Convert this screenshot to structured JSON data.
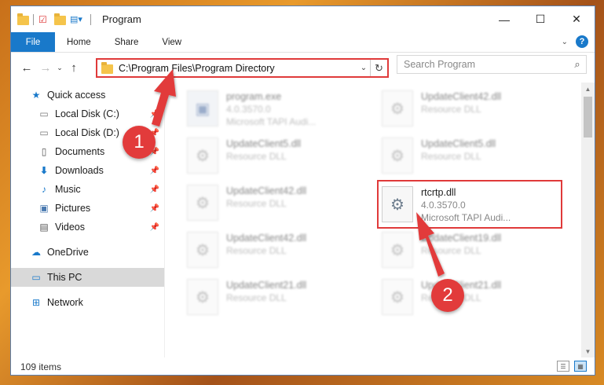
{
  "window": {
    "title": "Program"
  },
  "ribbon": {
    "tabs": [
      "File",
      "Home",
      "Share",
      "View"
    ]
  },
  "nav": {
    "address": "C:\\Program Files\\Program Directory",
    "search_placeholder": "Search Program"
  },
  "sidebar": {
    "items": [
      {
        "label": "Quick access",
        "icon": "star-icon",
        "pinned": false
      },
      {
        "label": "Local Disk (C:)",
        "icon": "drive-icon",
        "pinned": true
      },
      {
        "label": "Local Disk (D:)",
        "icon": "drive-icon",
        "pinned": true
      },
      {
        "label": "Documents",
        "icon": "documents-icon",
        "pinned": true
      },
      {
        "label": "Downloads",
        "icon": "download-icon",
        "pinned": true
      },
      {
        "label": "Music",
        "icon": "music-icon",
        "pinned": true
      },
      {
        "label": "Pictures",
        "icon": "pictures-icon",
        "pinned": true
      },
      {
        "label": "Videos",
        "icon": "videos-icon",
        "pinned": true
      }
    ],
    "onedrive": "OneDrive",
    "thispc": "This PC",
    "network": "Network"
  },
  "files": [
    {
      "name": "program.exe",
      "version": "4.0.3570.0",
      "desc": "Microsoft TAPI Audi...",
      "type": "exe"
    },
    {
      "name": "UpdateClient42.dll",
      "desc": "Resource DLL"
    },
    {
      "name": "UpdateClient5.dll",
      "desc": "Resource DLL"
    },
    {
      "name": "UpdateClient5.dll",
      "desc": "Resource DLL"
    },
    {
      "name": "UpdateClient42.dll",
      "desc": "Resource DLL"
    },
    {
      "name": "rtcrtp.dll",
      "version": "4.0.3570.0",
      "desc": "Microsoft TAPI Audi...",
      "highlighted": true
    },
    {
      "name": "UpdateClient42.dll",
      "desc": "Resource DLL"
    },
    {
      "name": "UpdateClient19.dll",
      "desc": "Resource DLL"
    },
    {
      "name": "UpdateClient21.dll",
      "desc": "Resource DLL"
    },
    {
      "name": "UpdateClient21.dll",
      "desc": "Resource DLL"
    }
  ],
  "status": {
    "count": "109 items"
  },
  "annotations": {
    "badge1": "1",
    "badge2": "2"
  },
  "colors": {
    "accent": "#1979ca",
    "highlight": "#e03a3a",
    "badge": "#e23b3b"
  }
}
